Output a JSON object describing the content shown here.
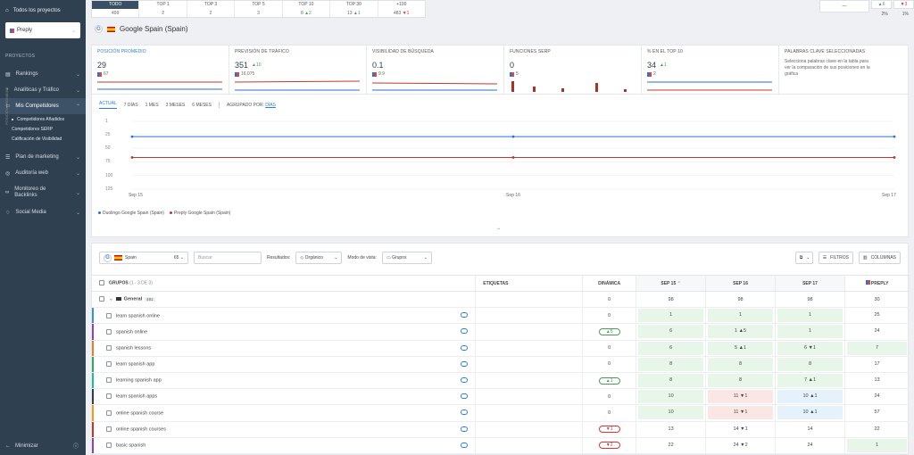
{
  "sidebar": {
    "all_projects": "Todos los proyectos",
    "project_select": "Preply",
    "section_label": "PROYECTOS",
    "items": [
      {
        "label": "Rankings"
      },
      {
        "label": "Analíticas y Tráfico"
      },
      {
        "label": "Mis Competidores"
      },
      {
        "label": "Plan de marketing"
      },
      {
        "label": "Auditoría web"
      },
      {
        "label": "Monitoreo de Backlinks"
      },
      {
        "label": "Social Media"
      }
    ],
    "subitems": [
      {
        "label": "Competidores Añadidos"
      },
      {
        "label": "Competidores SERP"
      },
      {
        "label": "Calificación de Visibilidad"
      }
    ],
    "minimize": "Minimizar"
  },
  "topstrip": [
    {
      "label": "TODO",
      "value": "499",
      "delta": ""
    },
    {
      "label": "TOP 1",
      "value": "2",
      "delta": ""
    },
    {
      "label": "TOP 3",
      "value": "2",
      "delta": ""
    },
    {
      "label": "TOP 5",
      "value": "3",
      "delta": ""
    },
    {
      "label": "TOP 10",
      "value": "8",
      "delta": "▲2"
    },
    {
      "label": "TOP 30",
      "value": "13",
      "delta": "▲1"
    },
    {
      "label": "+100",
      "value": "483",
      "delta": "▼1"
    }
  ],
  "rightstrip": {
    "box": "—",
    "a": "▲6",
    "b": "▼3",
    "va": "2%",
    "vb": "1%"
  },
  "title": "Google Spain (Spain)",
  "metrics": [
    {
      "label": "POSICIÓN PROMEDIO",
      "value": "29",
      "delta": "",
      "sub": "67"
    },
    {
      "label": "PREVISIÓN DE TRÁFICO",
      "value": "351",
      "delta": "▲10",
      "sub": "16,075"
    },
    {
      "label": "VISIBILIDAD DE BÚSQUEDA",
      "value": "0.1",
      "delta": "",
      "sub": "9.9"
    },
    {
      "label": "FUNCIONES SERP",
      "value": "0",
      "delta": "",
      "sub": "5"
    },
    {
      "label": "% EN EL TOP 10",
      "value": "34",
      "delta": "▲1",
      "sub": "2"
    },
    {
      "label": "PALABRAS CLAVE SELECCIONADAS",
      "desc": "Selecciona palabras clave en la tabla para ver la comparación de sus posiciones en la gráfica"
    }
  ],
  "chart": {
    "tabs": [
      "ACTUAL",
      "7 DÍAS",
      "1 MES",
      "3 MESES",
      "6 MESES"
    ],
    "grouped_label": "AGRUPADO POR:",
    "grouped_value": "DÍAS",
    "yaxis_title": "POSICIÓN PROMEDIO",
    "yticks": [
      "1",
      "25",
      "50",
      "75",
      "100",
      "125"
    ],
    "xticks": [
      "Sep 15",
      "Sep 16",
      "Sep 17"
    ],
    "legend": [
      "Duolingo Google Spain (Spain)",
      "Preply Google Spain (Spain)"
    ],
    "colors": {
      "blue": "#2a6fd6",
      "red": "#c0392b"
    }
  },
  "chart_data": {
    "type": "line",
    "x": [
      "Sep 15",
      "Sep 16",
      "Sep 17"
    ],
    "ylim": [
      1,
      125
    ],
    "series": [
      {
        "name": "Duolingo Google Spain (Spain)",
        "values": [
          29,
          29,
          29
        ]
      },
      {
        "name": "Preply Google Spain (Spain)",
        "values": [
          67,
          67,
          67
        ]
      }
    ]
  },
  "toolbar": {
    "engine": "Spain",
    "engine_count": "65",
    "search_placeholder": "Buscar",
    "results_label": "Resultados:",
    "results_value": "Orgánico",
    "view_label": "Modo de vista:",
    "view_value": "Grupos",
    "filters": "FILTROS",
    "columns": "COLUMNAS"
  },
  "table": {
    "headers": {
      "kw": "GRUPOS",
      "kw_count": "(1 - 3 DE 3)",
      "tags": "ETIQUETAS",
      "dyn": "DINÁMICA",
      "d1": "SEP 15",
      "d2": "SEP 16",
      "d3": "SEP 17",
      "comp": "PREPLY"
    },
    "group": {
      "name": "General",
      "count": "491",
      "dyn": "0",
      "d1": "98",
      "d2": "98",
      "d3": "98",
      "comp": "30"
    },
    "rows": [
      {
        "kw": "learn spanish online",
        "dyn": "0",
        "d1": "1",
        "d2": "1",
        "d3": "1",
        "comp": "25",
        "bar": "#3a8fd9"
      },
      {
        "kw": "spanish online",
        "dyn": "▲5",
        "d1": "6",
        "d2": "1 ▲5",
        "d3": "1",
        "comp": "24",
        "bar": "#8e44ad"
      },
      {
        "kw": "spanish lessons",
        "dyn": "0",
        "d1": "6",
        "d2": "5 ▲1",
        "d3": "6 ▼1",
        "comp": "7",
        "bar": "#e67e22"
      },
      {
        "kw": "learn spanish app",
        "dyn": "0",
        "d1": "8",
        "d2": "8",
        "d3": "8",
        "comp": "17",
        "bar": "#27ae60"
      },
      {
        "kw": "learning spanish app",
        "dyn": "▲1",
        "d1": "8",
        "d2": "8",
        "d3": "7 ▲1",
        "comp": "13",
        "bar": "#1abc9c"
      },
      {
        "kw": "learn spanish apps",
        "dyn": "0",
        "d1": "10",
        "d2": "11 ▼1",
        "d3": "10 ▲1",
        "comp": "24",
        "bar": "#2c3e50"
      },
      {
        "kw": "online spanish course",
        "dyn": "0",
        "d1": "10",
        "d2": "11 ▼1",
        "d3": "10 ▲1",
        "comp": "57",
        "bar": "#f39c12"
      },
      {
        "kw": "online spanish courses",
        "dyn": "▼1",
        "d1": "13",
        "d2": "14 ▼1",
        "d3": "14",
        "comp": "22",
        "bar": "#c0392b"
      },
      {
        "kw": "basic spanish",
        "dyn": "▼2",
        "d1": "22",
        "d2": "24 ▼2",
        "d3": "24",
        "comp": "1",
        "bar": "#8e44ad"
      }
    ]
  }
}
